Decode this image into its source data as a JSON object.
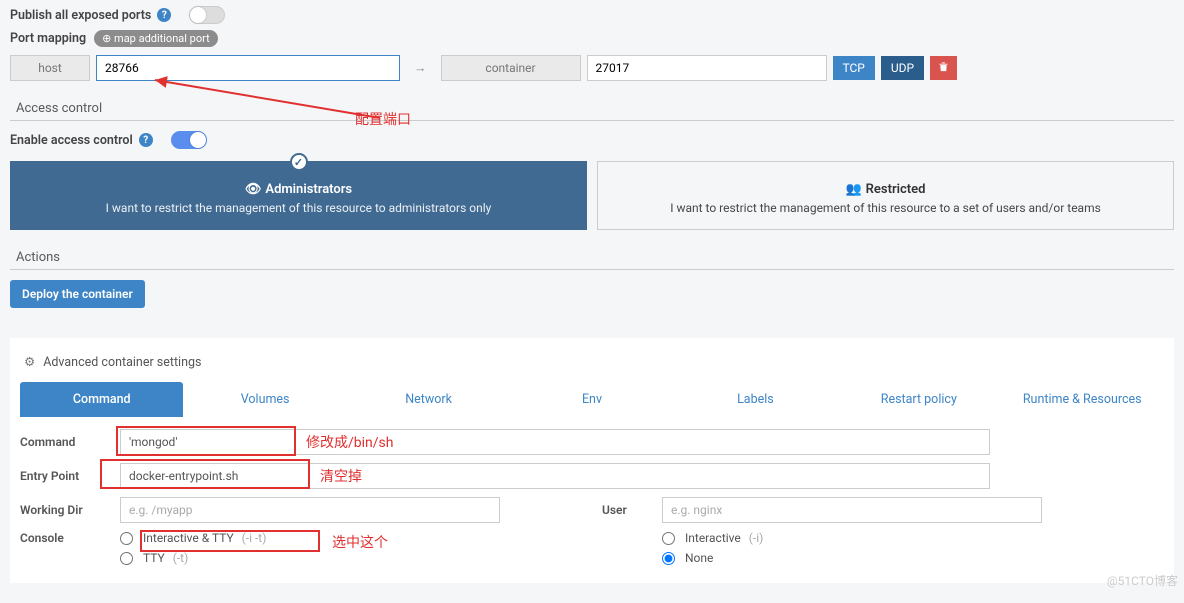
{
  "publishPorts": {
    "label": "Publish all exposed ports"
  },
  "portMapping": {
    "label": "Port mapping",
    "chip": "⊕ map additional port",
    "hostLabel": "host",
    "hostValue": "28766",
    "containerLabel": "container",
    "containerValue": "27017",
    "tcp": "TCP",
    "udp": "UDP"
  },
  "accessControlSection": "Access control",
  "enableAccess": {
    "label": "Enable access control"
  },
  "panels": {
    "admin": {
      "title": "Administrators",
      "sub": "I want to restrict the management of this resource to administrators only",
      "icon": "👁̶"
    },
    "restricted": {
      "title": "Restricted",
      "sub": "I want to restrict the management of this resource to a set of users and/or teams",
      "icon": "👥"
    }
  },
  "actionsSection": "Actions",
  "deployBtn": "Deploy the container",
  "advanced": {
    "title": "Advanced container settings",
    "tabs": [
      "Command",
      "Volumes",
      "Network",
      "Env",
      "Labels",
      "Restart policy",
      "Runtime & Resources"
    ],
    "commandLabel": "Command",
    "commandValue": "'mongod'",
    "entryLabel": "Entry Point",
    "entryValue": "docker-entrypoint.sh",
    "workdirLabel": "Working Dir",
    "workdirPlaceholder": "e.g. /myapp",
    "userLabel": "User",
    "userPlaceholder": "e.g. nginx",
    "consoleLabel": "Console",
    "opts": {
      "both": "Interactive & TTY",
      "bothHint": "(-i -t)",
      "interactive": "Interactive",
      "interactiveHint": "(-i)",
      "tty": "TTY",
      "ttyHint": "(-t)",
      "none": "None"
    }
  },
  "annotations": {
    "portNote": "配置端口",
    "cmdNote": "修改成/bin/sh",
    "entryNote": "清空掉",
    "consoleNote": "选中这个"
  },
  "watermark": "@51CTO博客"
}
